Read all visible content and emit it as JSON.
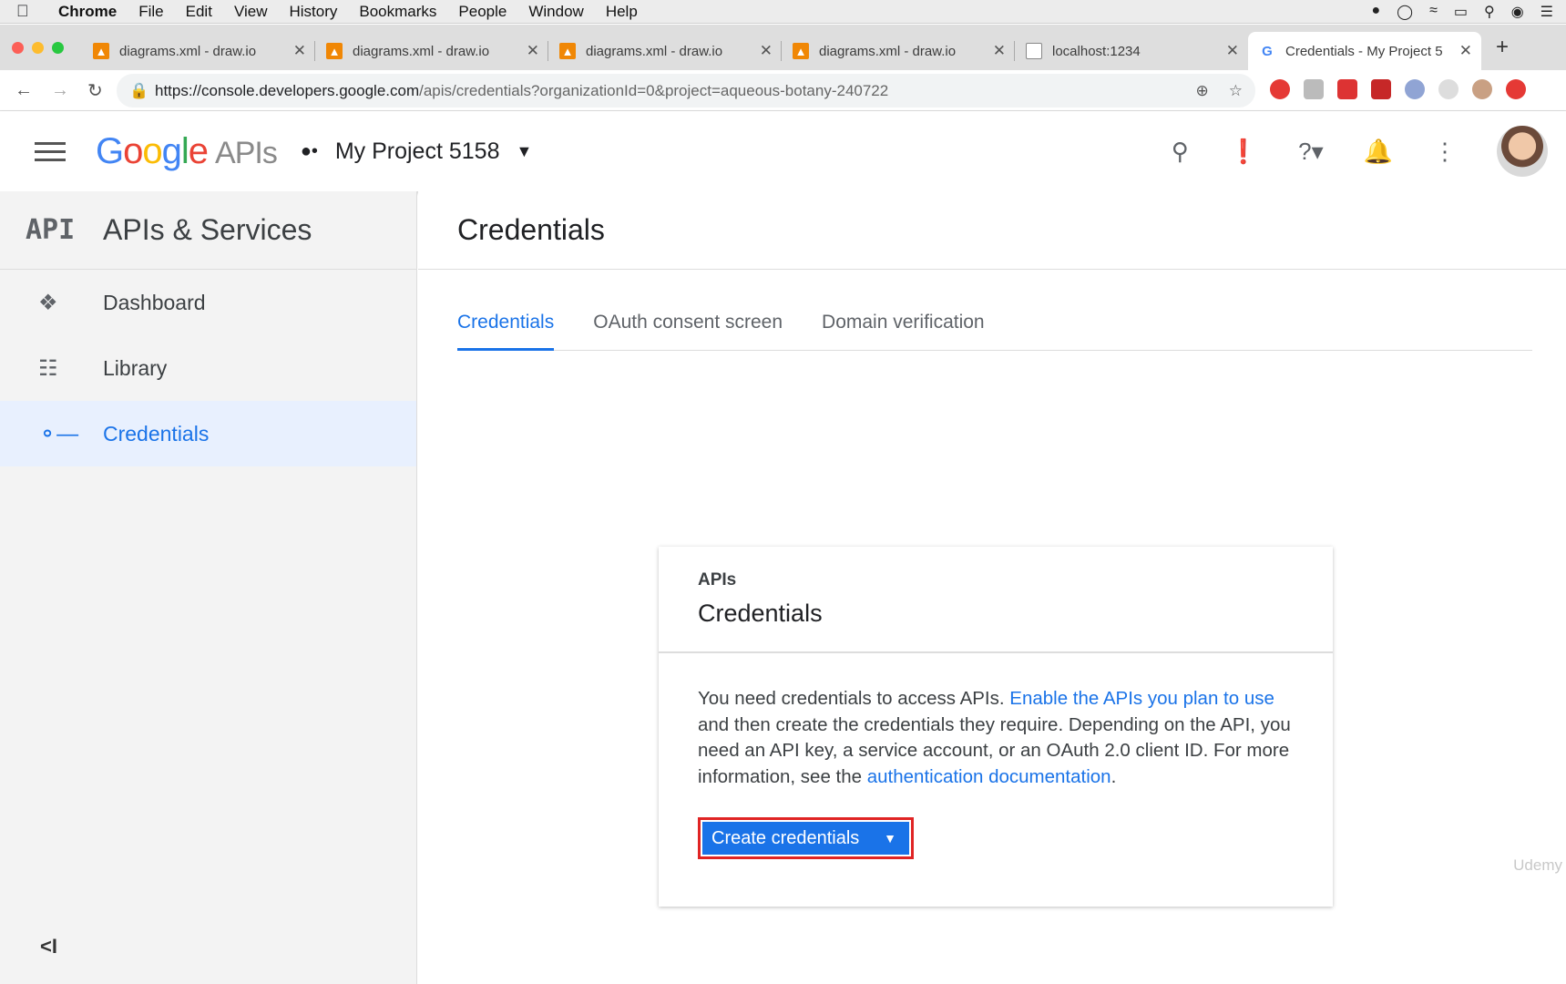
{
  "menubar": {
    "app": "Chrome",
    "items": [
      "File",
      "Edit",
      "View",
      "History",
      "Bookmarks",
      "People",
      "Window",
      "Help"
    ]
  },
  "tabs": [
    {
      "title": "diagrams.xml - draw.io",
      "icon": "drawio-icon"
    },
    {
      "title": "diagrams.xml - draw.io",
      "icon": "drawio-icon"
    },
    {
      "title": "diagrams.xml - draw.io",
      "icon": "drawio-icon"
    },
    {
      "title": "diagrams.xml - draw.io",
      "icon": "drawio-icon"
    },
    {
      "title": "localhost:1234",
      "icon": "page-icon"
    },
    {
      "title": "Credentials - My Project 5",
      "icon": "google-icon"
    }
  ],
  "url": {
    "host": "https://console.developers.google.com",
    "path": "/apis/credentials?organizationId=0&project=aqueous-botany-240722"
  },
  "appbar": {
    "logo": "Google",
    "logo_suffix": "APIs",
    "project": "My Project 5158"
  },
  "sidebar": {
    "section_title": "APIs & Services",
    "logo_text": "API",
    "items": [
      {
        "label": "Dashboard"
      },
      {
        "label": "Library"
      },
      {
        "label": "Credentials"
      }
    ],
    "collapse": "<I"
  },
  "main": {
    "title": "Credentials",
    "tabs": [
      "Credentials",
      "OAuth consent screen",
      "Domain verification"
    ]
  },
  "card": {
    "subtitle": "APIs",
    "title": "Credentials",
    "text_1": "You need credentials to access APIs. ",
    "link_1": "Enable the APIs you plan to use",
    "text_2": " and then create the credentials they require. Depending on the API, you need an API key, a service account, or an OAuth 2.0 client ID. For more information, see the ",
    "link_2": "authentication documentation",
    "text_3": ".",
    "button": "Create credentials"
  },
  "watermark": "Udemy",
  "colors": {
    "accent": "#1a73e8",
    "highlight": "#e02424"
  }
}
